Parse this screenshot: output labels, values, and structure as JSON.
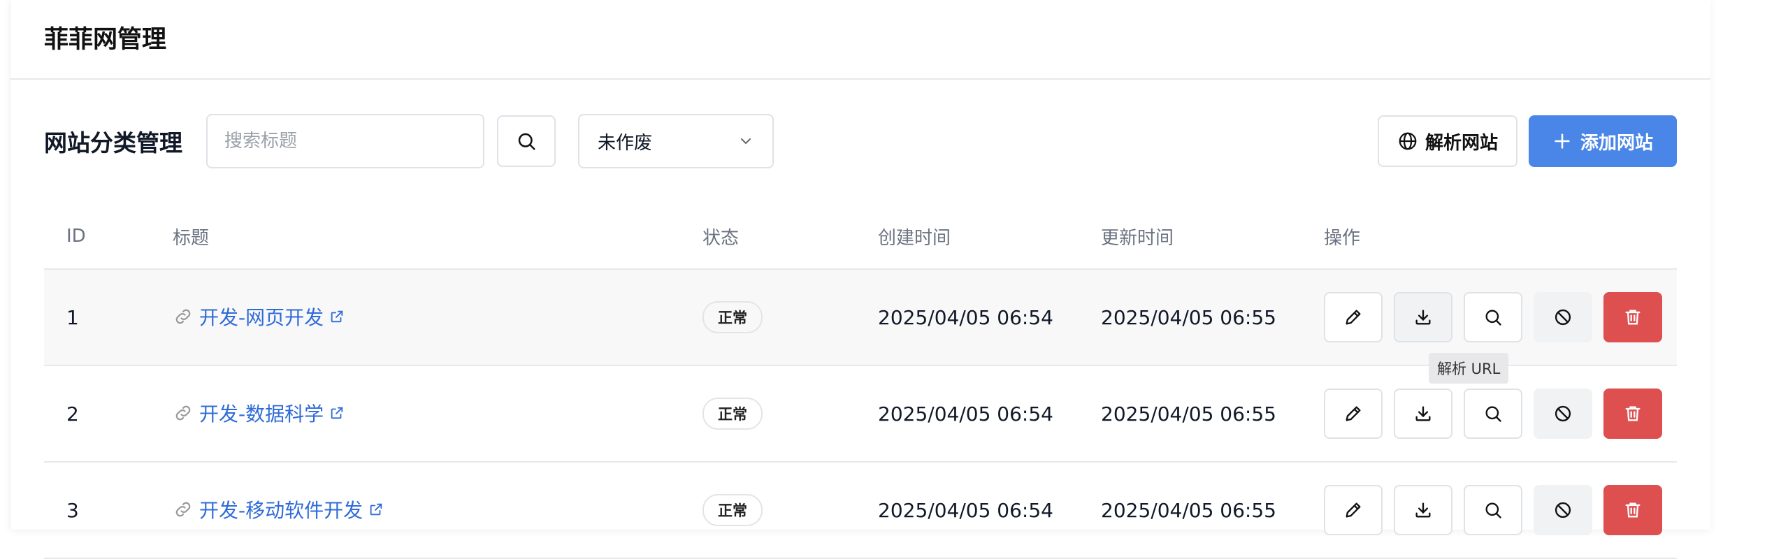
{
  "header": {
    "title": "菲菲网管理"
  },
  "toolbar": {
    "section_title": "网站分类管理",
    "search_placeholder": "搜索标题",
    "filter_value": "未作废",
    "parse_site_label": "解析网站",
    "add_site_label": "添加网站"
  },
  "table": {
    "columns": {
      "id": "ID",
      "title": "标题",
      "status": "状态",
      "created": "创建时间",
      "updated": "更新时间",
      "actions": "操作"
    },
    "rows": [
      {
        "id": "1",
        "title": "开发-网页开发",
        "status": "正常",
        "created": "2025/04/05 06:54",
        "updated": "2025/04/05 06:55"
      },
      {
        "id": "2",
        "title": "开发-数据科学",
        "status": "正常",
        "created": "2025/04/05 06:54",
        "updated": "2025/04/05 06:55"
      },
      {
        "id": "3",
        "title": "开发-移动软件开发",
        "status": "正常",
        "created": "2025/04/05 06:54",
        "updated": "2025/04/05 06:55"
      }
    ]
  },
  "tooltip": {
    "text": "解析 URL"
  },
  "colors": {
    "primary": "#4a86e8",
    "danger": "#de4f4f",
    "link": "#2f6bd8"
  },
  "icons": [
    "search-icon",
    "chevron-down-icon",
    "globe-icon",
    "plus-icon",
    "link-icon",
    "external-link-icon",
    "pencil-icon",
    "download-icon",
    "search-icon",
    "ban-icon",
    "trash-icon"
  ]
}
